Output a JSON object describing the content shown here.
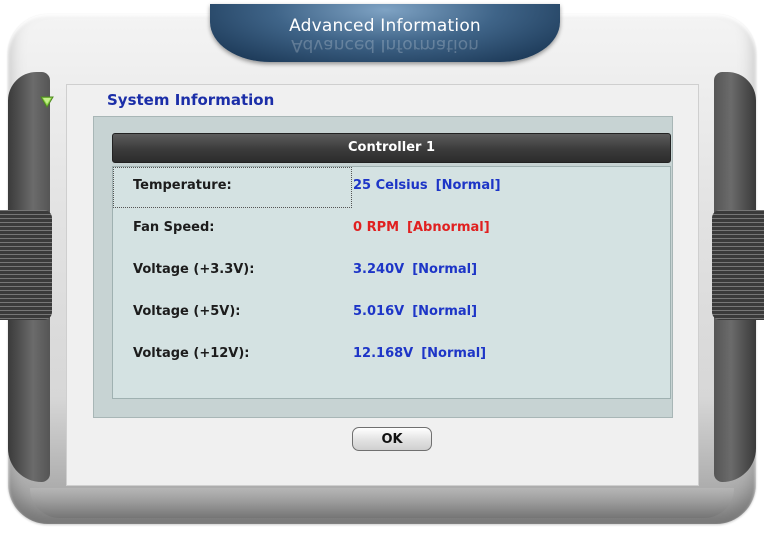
{
  "window": {
    "title": "Advanced Information"
  },
  "section": {
    "title": "System Information"
  },
  "controller": {
    "header": "Controller 1"
  },
  "rows": [
    {
      "label": "Temperature:",
      "value": "25 Celsius",
      "status": "[Normal]"
    },
    {
      "label": "Fan Speed:",
      "value": "0 RPM",
      "status": "[Abnormal]"
    },
    {
      "label": "Voltage (+3.3V):",
      "value": "3.240V",
      "status": "[Normal]"
    },
    {
      "label": "Voltage (+5V):",
      "value": "5.016V",
      "status": "[Normal]"
    },
    {
      "label": "Voltage (+12V):",
      "value": "12.168V",
      "status": "[Normal]"
    }
  ],
  "buttons": {
    "ok": "OK"
  },
  "colors": {
    "normal": "#1d35c7",
    "abnormal": "#e02020",
    "title_bar": "#2c4f74"
  },
  "icons": {
    "section": "triangle-down-icon"
  }
}
